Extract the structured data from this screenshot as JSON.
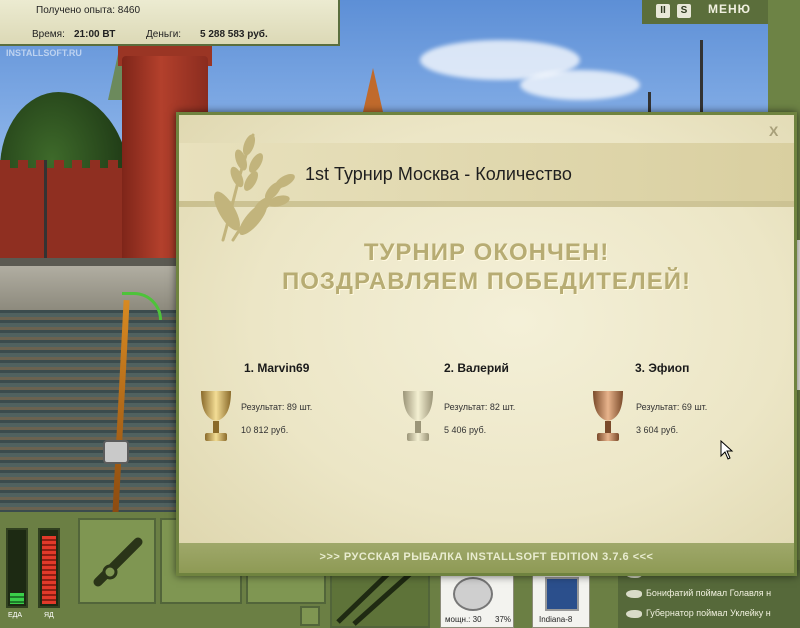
{
  "hud": {
    "experience_label": "Получено опыта:",
    "experience_value": "8460",
    "time_label": "Время:",
    "time_value": "21:00 ВТ",
    "money_label": "Деньги:",
    "money_value": "5 288 583 руб.",
    "watermark": "INSTALLSOFT.RU"
  },
  "top_right": {
    "pause_glyph": "II",
    "sound_glyph": "S",
    "menu_label": "МЕНЮ"
  },
  "modal": {
    "title": "1st Турнир Москва - Количество",
    "close_glyph": "X",
    "headline_1": "ТУРНИР ОКОНЧЕН!",
    "headline_2": "ПОЗДРАВЛЯЕМ ПОБЕДИТЕЛЕЙ!",
    "winners": [
      {
        "name": "1. Marvin69",
        "result": "Результат: 89 шт.",
        "prize": "10 812 руб.",
        "trophy": "gold"
      },
      {
        "name": "2. Валерий",
        "result": "Результат: 82 шт.",
        "prize": "5 406 руб.",
        "trophy": "silver"
      },
      {
        "name": "3. Эфиоп",
        "result": "Результат: 69 шт.",
        "prize": "3 604 руб.",
        "trophy": "bronze"
      }
    ],
    "footer": ">>> РУССКАЯ РЫБАЛКА INSTALLSOFT EDITION 3.7.6 <<<"
  },
  "bottom": {
    "meter_food_label": "ЕДА",
    "meter_poison_label": "ЯД",
    "meter_food_level": 0.15,
    "meter_poison_level": 0.95,
    "inv_power": "мощн.: 30",
    "inv_percent": "37%",
    "inv_bait": "Indiana-8"
  },
  "feed": [
    "Бонифатий поймал Голавля н",
    "Губернатор поймал Уклейку н"
  ],
  "colors": {
    "modal_border": "#6f833f",
    "headline": "#b7ac73",
    "hud_bg": "#ecebd1",
    "bottom_bg": "#6b7f44"
  }
}
